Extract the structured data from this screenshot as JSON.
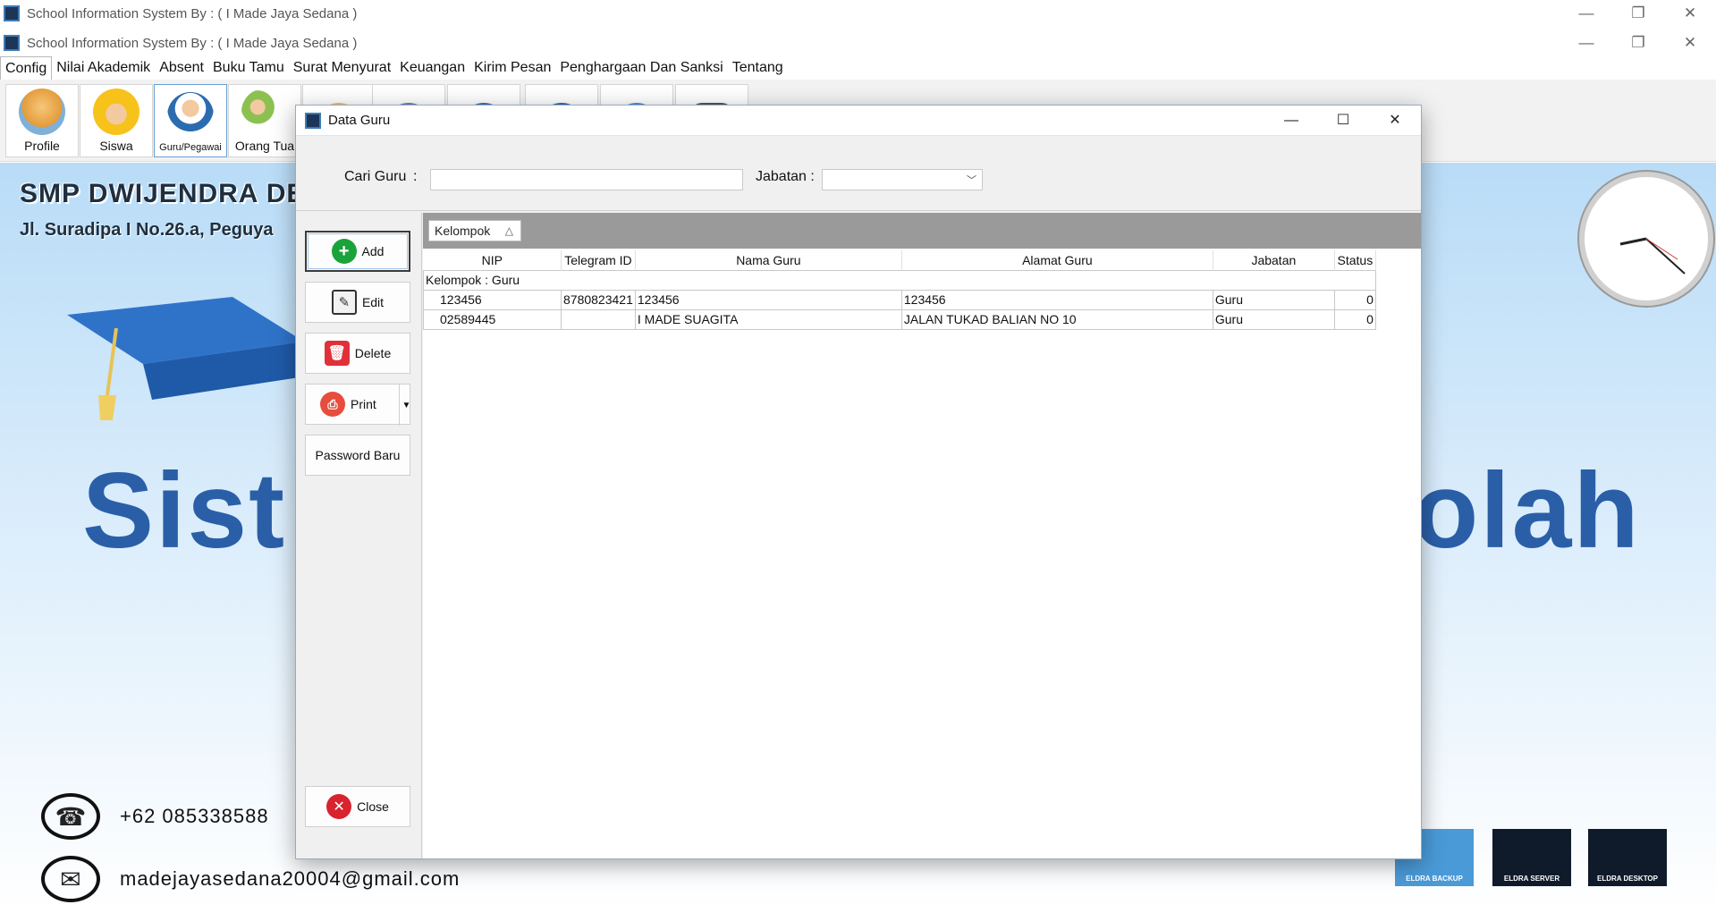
{
  "app": {
    "title": "School Information System By : ( I Made Jaya Sedana )",
    "minimize": "—",
    "restore": "❐",
    "close": "✕"
  },
  "menu": [
    "Config",
    "Nilai Akademik",
    "Absent",
    "Buku Tamu",
    "Surat Menyurat",
    "Keuangan",
    "Kirim Pesan",
    "Penghargaan Dan Sanksi",
    "Tentang"
  ],
  "ribbon": {
    "profile": "Profile",
    "siswa": "Siswa",
    "guru": "Guru/Pegawai",
    "ortu": "Orang Tua"
  },
  "background": {
    "school_name": "SMP DWIJENDRA DE",
    "address": "Jl. Suradipa I No.26.a, Peguya",
    "big_left": "Sist",
    "big_right": "olah",
    "phone": "+62 085338588",
    "email": "madejayasedana20004@gmail.com",
    "brand1": "ELDRA BACKUP",
    "brand2": "ELDRA SERVER",
    "brand3": "ELDRA DESKTOP"
  },
  "dialog": {
    "title": "Data Guru",
    "search_label": "Cari Guru",
    "colon": ":",
    "search_value": "",
    "jabatan_label": "Jabatan :",
    "jabatan_value": "",
    "buttons": {
      "add": "Add",
      "edit": "Edit",
      "delete": "Delete",
      "print": "Print",
      "password": "Password Baru",
      "close": "Close"
    },
    "group_chip": "Kelompok",
    "group_row": "Kelompok : Guru",
    "columns": [
      "NIP",
      "Telegram ID",
      "Nama Guru",
      "Alamat Guru",
      "Jabatan",
      "Status"
    ],
    "rows": [
      [
        "123456",
        "8780823421",
        "123456",
        "123456",
        "Guru",
        "0"
      ],
      [
        "02589445",
        "",
        "I MADE SUAGITA",
        "JALAN TUKAD BALIAN NO 10",
        "Guru",
        "0"
      ]
    ]
  },
  "colors": {
    "accent": "#2a5fa8",
    "add_green": "#1aa33a",
    "delete_red": "#e0313a",
    "close_red": "#d9232e"
  }
}
